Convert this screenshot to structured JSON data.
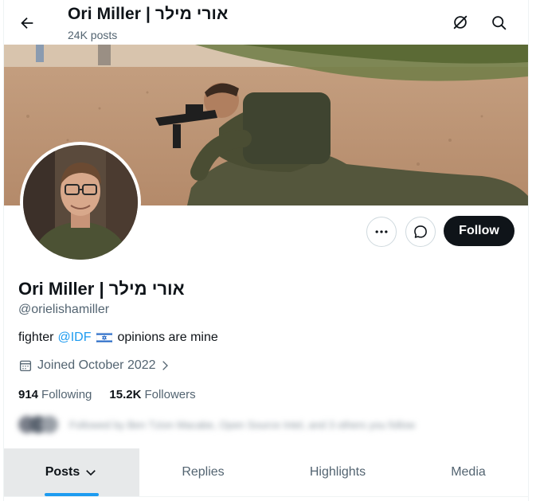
{
  "header": {
    "title": "Ori Miller | אורי מילר",
    "posts_count": "24K posts",
    "icons": [
      "back-arrow-icon",
      "grok-icon",
      "search-icon"
    ]
  },
  "profile": {
    "name": "Ori Miller | אורי מילר",
    "handle": "@orielishamiller",
    "bio_prefix": "fighter",
    "bio_mention": "@IDF",
    "bio_suffix": "opinions are mine",
    "joined": "Joined October 2022",
    "following_count": "914",
    "following_label": "Following",
    "followers_count": "15.2K",
    "followers_label": "Followers",
    "followed_by": "Followed by Ben Tzion Macabe, Open Source Intel, and 3 others you follow"
  },
  "actions": {
    "follow_label": "Follow",
    "more_icon": "more-icon",
    "message_icon": "message-icon"
  },
  "tabs": [
    {
      "label": "Posts",
      "active": true
    },
    {
      "label": "Replies",
      "active": false
    },
    {
      "label": "Highlights",
      "active": false
    },
    {
      "label": "Media",
      "active": false
    }
  ],
  "colors": {
    "accent": "#1d9bf0",
    "text": "#0f1419",
    "secondary": "#536471",
    "follow_bg": "#0f1419"
  }
}
